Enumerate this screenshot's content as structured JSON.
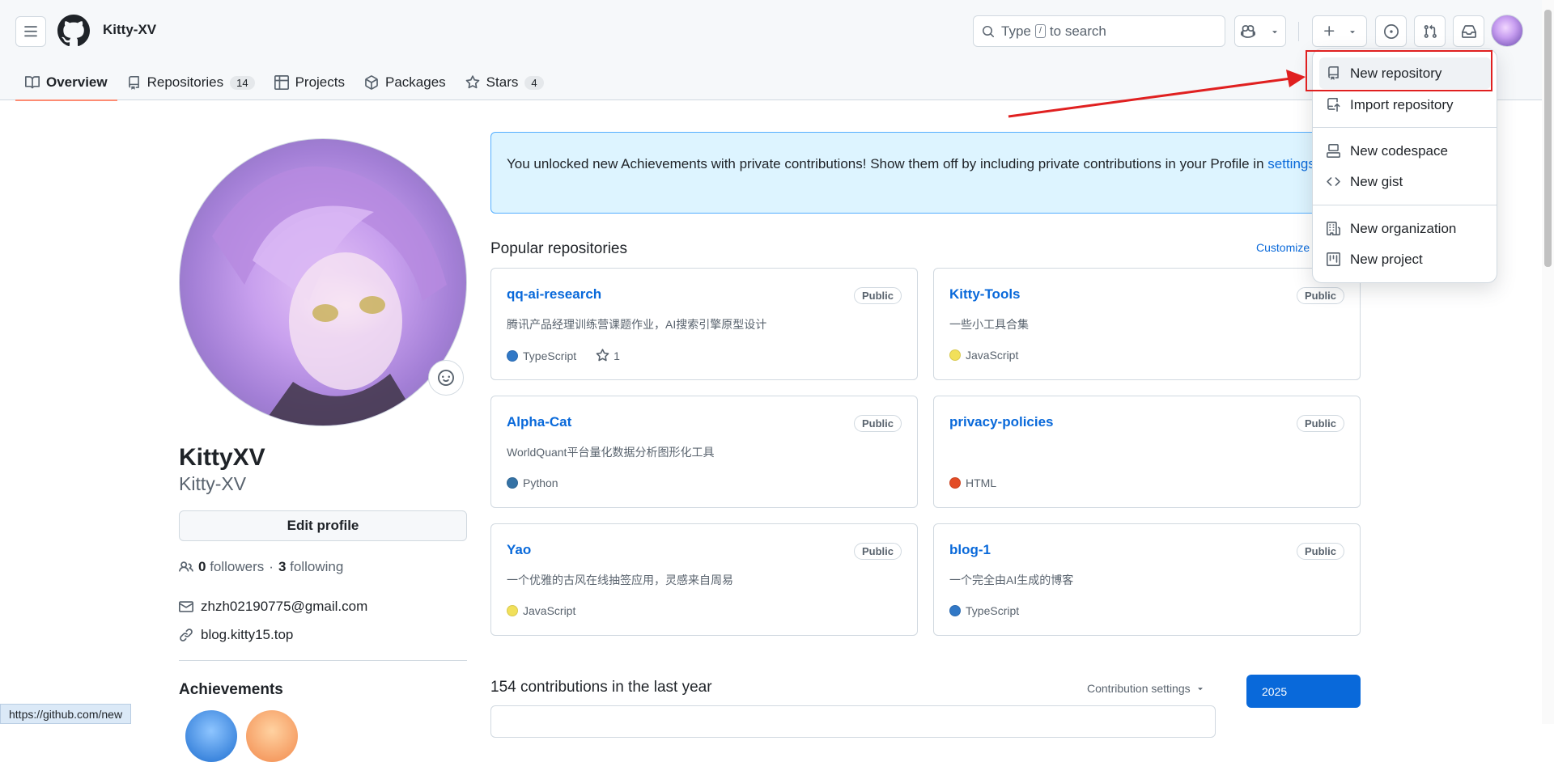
{
  "header": {
    "username": "Kitty-XV",
    "search": {
      "prefix": "Type",
      "key": "/",
      "suffix": "to search"
    }
  },
  "tabs": [
    {
      "label": "Overview",
      "count": ""
    },
    {
      "label": "Repositories",
      "count": "14"
    },
    {
      "label": "Projects",
      "count": ""
    },
    {
      "label": "Packages",
      "count": ""
    },
    {
      "label": "Stars",
      "count": "4"
    }
  ],
  "profile": {
    "name": "KittyXV",
    "login": "Kitty-XV",
    "edit_label": "Edit profile",
    "followers_count": "0",
    "followers_label": "followers",
    "sep": "·",
    "following_count": "3",
    "following_label": "following",
    "email": "zhzh02190775@gmail.com",
    "website": "blog.kitty15.top",
    "achievements_title": "Achievements"
  },
  "flash": {
    "text": "You unlocked new Achievements with private contributions! Show them off by including private contributions in your Profile in",
    "link": "settings",
    "end": "."
  },
  "popular": {
    "title": "Popular repositories",
    "customize": "Customize",
    "repos": [
      {
        "name": "qq-ai-research",
        "visibility": "Public",
        "description": "腾讯产品经理训练营课题作业，AI搜索引擎原型设计",
        "language": "TypeScript",
        "lang_color": "#3178c6",
        "stars": "1"
      },
      {
        "name": "Kitty-Tools",
        "visibility": "Public",
        "description": "一些小工具合集",
        "language": "JavaScript",
        "lang_color": "#f1e05a",
        "stars": ""
      },
      {
        "name": "Alpha-Cat",
        "visibility": "Public",
        "description": "WorldQuant平台量化数据分析图形化工具",
        "language": "Python",
        "lang_color": "#3572A5",
        "stars": ""
      },
      {
        "name": "privacy-policies",
        "visibility": "Public",
        "description": "",
        "language": "HTML",
        "lang_color": "#e34c26",
        "stars": ""
      },
      {
        "name": "Yao",
        "visibility": "Public",
        "description": "一个优雅的古风在线抽签应用，灵感来自周易",
        "language": "JavaScript",
        "lang_color": "#f1e05a",
        "stars": ""
      },
      {
        "name": "blog-1",
        "visibility": "Public",
        "description": "一个完全由AI生成的博客",
        "language": "TypeScript",
        "lang_color": "#3178c6",
        "stars": ""
      }
    ]
  },
  "contributions": {
    "title": "154 contributions in the last year",
    "settings": "Contribution settings",
    "year": "2025"
  },
  "create_menu": {
    "items": [
      {
        "label": "New repository",
        "icon": "repo-icon"
      },
      {
        "label": "Import repository",
        "icon": "repo-push-icon"
      },
      {
        "label": "New codespace",
        "icon": "codespaces-icon"
      },
      {
        "label": "New gist",
        "icon": "code-icon"
      },
      {
        "label": "New organization",
        "icon": "organization-icon"
      },
      {
        "label": "New project",
        "icon": "project-icon"
      }
    ]
  },
  "status_bar": {
    "url": "https://github.com/new"
  },
  "colors": {
    "accent": "#0969da",
    "tab_underline": "#fd8c73",
    "annotation": "#e02020"
  }
}
